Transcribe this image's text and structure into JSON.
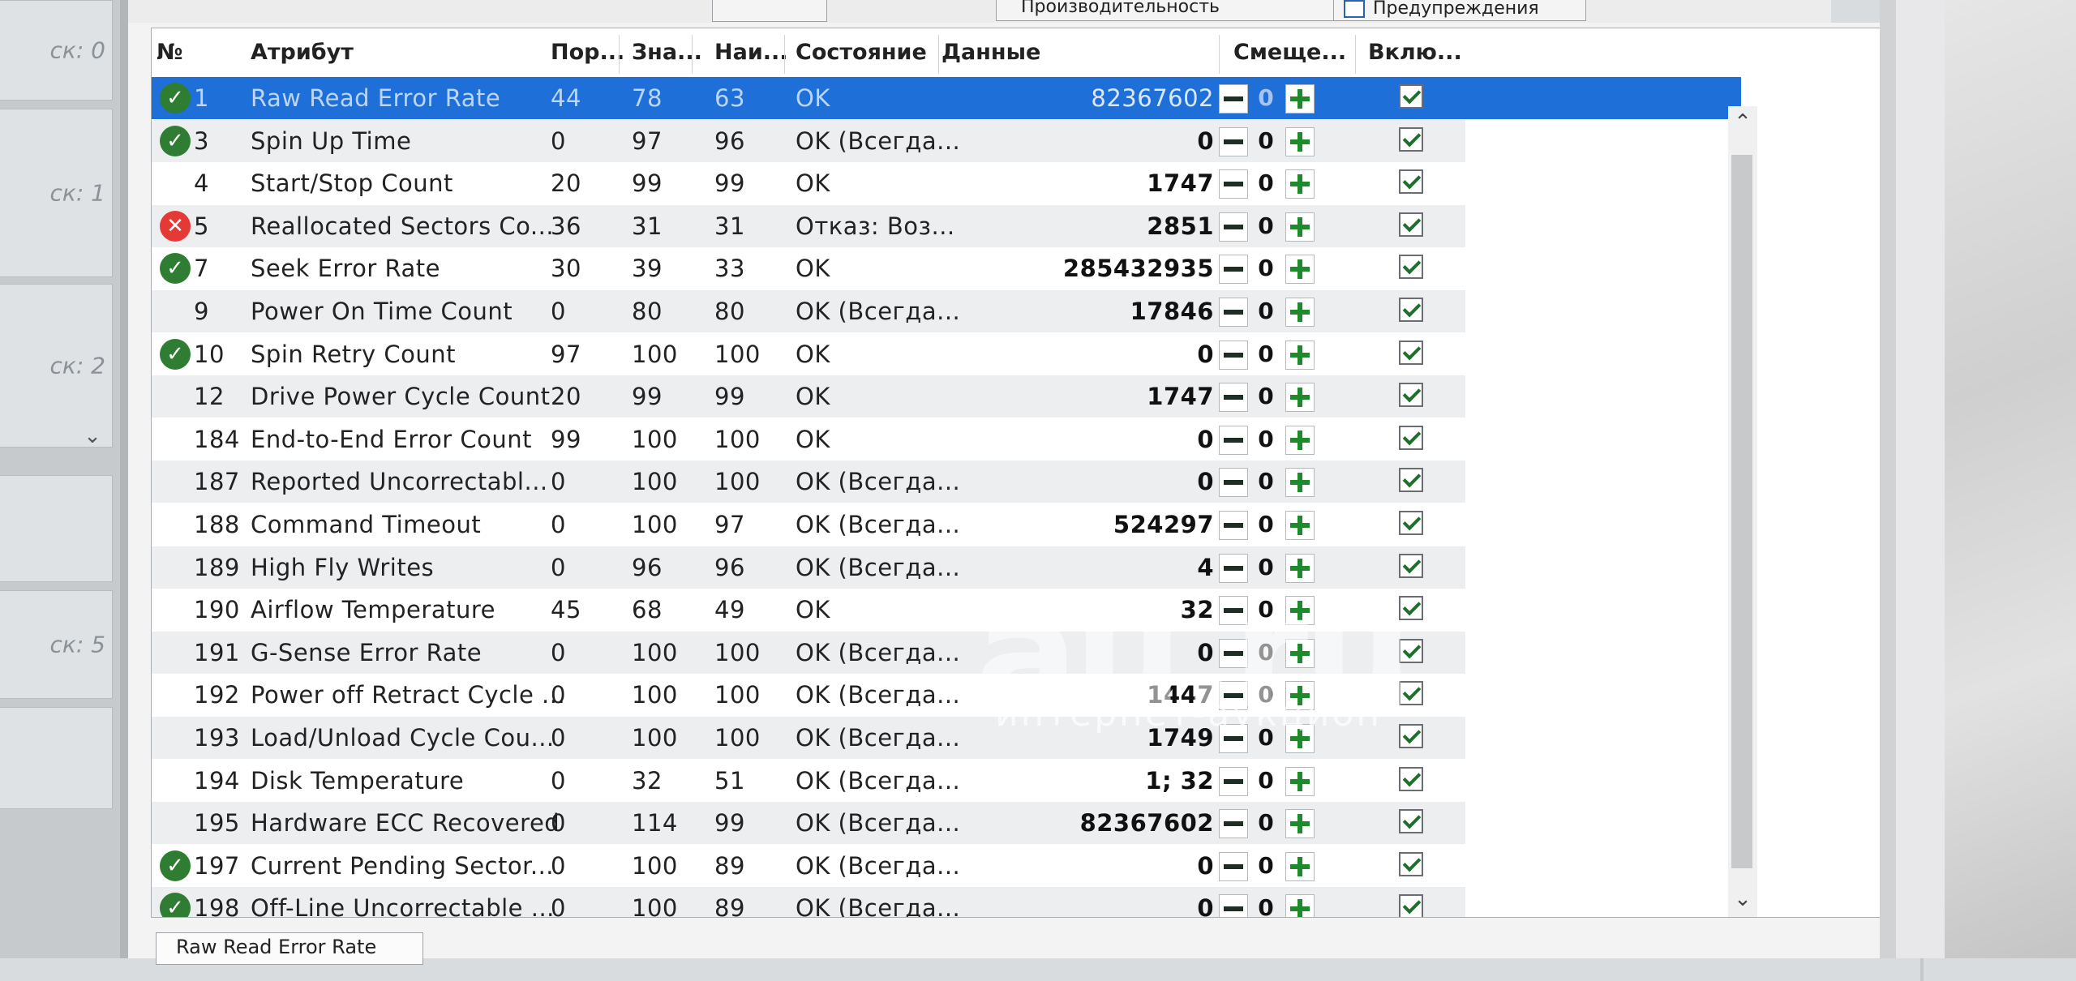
{
  "toolbar": {
    "tab_partial": "Производительность",
    "warnings": "Предупреждения"
  },
  "side_panel": {
    "disk_labels": [
      "ск: 0",
      "ск: 1",
      "ск: 2",
      "ск: 5"
    ]
  },
  "columns": {
    "num": "№",
    "attribute": "Атрибут",
    "threshold": "Пор...",
    "value": "Зна...",
    "worst": "Наи...",
    "state": "Состояние",
    "data": "Данные",
    "offset": "Смеще...",
    "enabled": "Вклю..."
  },
  "rows": [
    {
      "id": "1",
      "name": "Raw Read Error Rate",
      "thr": "44",
      "val": "78",
      "worst": "63",
      "state": "OK",
      "data": "82367602",
      "offset": "0",
      "status": "ok"
    },
    {
      "id": "3",
      "name": "Spin Up Time",
      "thr": "0",
      "val": "97",
      "worst": "96",
      "state": "OK (Всегда...",
      "data": "0",
      "offset": "0",
      "status": "ok"
    },
    {
      "id": "4",
      "name": "Start/Stop Count",
      "thr": "20",
      "val": "99",
      "worst": "99",
      "state": "OK",
      "data": "1747",
      "offset": "0",
      "status": ""
    },
    {
      "id": "5",
      "name": "Reallocated Sectors Co...",
      "thr": "36",
      "val": "31",
      "worst": "31",
      "state": "Отказ: Воз...",
      "data": "2851",
      "offset": "0",
      "status": "bad"
    },
    {
      "id": "7",
      "name": "Seek Error Rate",
      "thr": "30",
      "val": "39",
      "worst": "33",
      "state": "OK",
      "data": "285432935",
      "offset": "0",
      "status": "ok"
    },
    {
      "id": "9",
      "name": "Power On Time Count",
      "thr": "0",
      "val": "80",
      "worst": "80",
      "state": "OK (Всегда...",
      "data": "17846",
      "offset": "0",
      "status": ""
    },
    {
      "id": "10",
      "name": "Spin Retry Count",
      "thr": "97",
      "val": "100",
      "worst": "100",
      "state": "OK",
      "data": "0",
      "offset": "0",
      "status": "ok"
    },
    {
      "id": "12",
      "name": "Drive Power Cycle Count",
      "thr": "20",
      "val": "99",
      "worst": "99",
      "state": "OK",
      "data": "1747",
      "offset": "0",
      "status": ""
    },
    {
      "id": "184",
      "name": "End-to-End Error Count",
      "thr": "99",
      "val": "100",
      "worst": "100",
      "state": "OK",
      "data": "0",
      "offset": "0",
      "status": ""
    },
    {
      "id": "187",
      "name": "Reported Uncorrectabl...",
      "thr": "0",
      "val": "100",
      "worst": "100",
      "state": "OK (Всегда...",
      "data": "0",
      "offset": "0",
      "status": ""
    },
    {
      "id": "188",
      "name": "Command Timeout",
      "thr": "0",
      "val": "100",
      "worst": "97",
      "state": "OK (Всегда...",
      "data": "524297",
      "offset": "0",
      "status": ""
    },
    {
      "id": "189",
      "name": "High Fly Writes",
      "thr": "0",
      "val": "96",
      "worst": "96",
      "state": "OK (Всегда...",
      "data": "4",
      "offset": "0",
      "status": ""
    },
    {
      "id": "190",
      "name": "Airflow Temperature",
      "thr": "45",
      "val": "68",
      "worst": "49",
      "state": "OK",
      "data": "32",
      "offset": "0",
      "status": ""
    },
    {
      "id": "191",
      "name": "G-Sense Error Rate",
      "thr": "0",
      "val": "100",
      "worst": "100",
      "state": "OK (Всегда...",
      "data": "0",
      "offset": "0",
      "status": ""
    },
    {
      "id": "192",
      "name": "Power off Retract Cycle ...",
      "thr": "0",
      "val": "100",
      "worst": "100",
      "state": "OK (Всегда...",
      "data": "1447",
      "offset": "0",
      "status": ""
    },
    {
      "id": "193",
      "name": "Load/Unload Cycle Cou...",
      "thr": "0",
      "val": "100",
      "worst": "100",
      "state": "OK (Всегда...",
      "data": "1749",
      "offset": "0",
      "status": ""
    },
    {
      "id": "194",
      "name": "Disk Temperature",
      "thr": "0",
      "val": "32",
      "worst": "51",
      "state": "OK (Всегда...",
      "data": "1; 32",
      "offset": "0",
      "status": ""
    },
    {
      "id": "195",
      "name": "Hardware ECC Recovered",
      "thr": "0",
      "val": "114",
      "worst": "99",
      "state": "OK (Всегда...",
      "data": "82367602",
      "offset": "0",
      "status": ""
    },
    {
      "id": "197",
      "name": "Current Pending Sector...",
      "thr": "0",
      "val": "100",
      "worst": "89",
      "state": "OK (Всегда...",
      "data": "0",
      "offset": "0",
      "status": "ok"
    },
    {
      "id": "198",
      "name": "Off-Line Uncorrectable ...",
      "thr": "0",
      "val": "100",
      "worst": "89",
      "state": "OK (Всегда...",
      "data": "0",
      "offset": "0",
      "status": "ok"
    }
  ],
  "bottom_tab": "Raw Read Error Rate",
  "watermark": {
    "brand": "au.ru",
    "tagline": "интернет-аукцион"
  },
  "colors": {
    "selection": "#1f6fd9",
    "ok": "#2e7d32",
    "fail": "#e53935",
    "plus": "#1e8a2c"
  }
}
